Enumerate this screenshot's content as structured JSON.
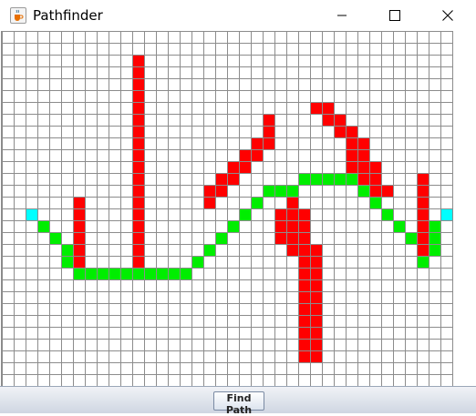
{
  "window": {
    "title": "Pathfinder",
    "app_icon": "java-coffee-cup-icon",
    "controls": [
      "minimize-icon",
      "maximize-icon",
      "close-icon"
    ]
  },
  "grid": {
    "cols": 38,
    "rows": 30,
    "colors": {
      "empty": "#ffffff",
      "line": "#8c8c8c",
      "wall": "#ff0000",
      "path": "#00ee00",
      "endpoint": "#00ffff"
    },
    "walls": [
      [
        11,
        2
      ],
      [
        11,
        3
      ],
      [
        11,
        4
      ],
      [
        11,
        5
      ],
      [
        11,
        6
      ],
      [
        11,
        7
      ],
      [
        11,
        8
      ],
      [
        11,
        9
      ],
      [
        11,
        10
      ],
      [
        11,
        11
      ],
      [
        11,
        12
      ],
      [
        11,
        13
      ],
      [
        11,
        14
      ],
      [
        11,
        15
      ],
      [
        11,
        16
      ],
      [
        11,
        17
      ],
      [
        11,
        18
      ],
      [
        11,
        19
      ],
      [
        6,
        14
      ],
      [
        6,
        15
      ],
      [
        6,
        16
      ],
      [
        6,
        17
      ],
      [
        6,
        18
      ],
      [
        6,
        19
      ],
      [
        22,
        7
      ],
      [
        22,
        8
      ],
      [
        22,
        9
      ],
      [
        21,
        9
      ],
      [
        21,
        10
      ],
      [
        20,
        10
      ],
      [
        20,
        11
      ],
      [
        19,
        11
      ],
      [
        19,
        12
      ],
      [
        18,
        12
      ],
      [
        18,
        13
      ],
      [
        17,
        13
      ],
      [
        17,
        14
      ],
      [
        26,
        6
      ],
      [
        27,
        6
      ],
      [
        27,
        7
      ],
      [
        28,
        7
      ],
      [
        28,
        8
      ],
      [
        29,
        8
      ],
      [
        29,
        9
      ],
      [
        30,
        9
      ],
      [
        29,
        10
      ],
      [
        30,
        10
      ],
      [
        29,
        11
      ],
      [
        30,
        11
      ],
      [
        31,
        11
      ],
      [
        30,
        12
      ],
      [
        31,
        12
      ],
      [
        31,
        13
      ],
      [
        32,
        13
      ],
      [
        24,
        14
      ],
      [
        24,
        15
      ],
      [
        23,
        15
      ],
      [
        25,
        15
      ],
      [
        23,
        16
      ],
      [
        24,
        16
      ],
      [
        25,
        16
      ],
      [
        23,
        17
      ],
      [
        24,
        17
      ],
      [
        25,
        17
      ],
      [
        24,
        18
      ],
      [
        25,
        18
      ],
      [
        26,
        18
      ],
      [
        25,
        19
      ],
      [
        26,
        19
      ],
      [
        25,
        20
      ],
      [
        26,
        20
      ],
      [
        25,
        21
      ],
      [
        26,
        21
      ],
      [
        25,
        22
      ],
      [
        26,
        22
      ],
      [
        25,
        23
      ],
      [
        26,
        23
      ],
      [
        25,
        24
      ],
      [
        26,
        24
      ],
      [
        25,
        25
      ],
      [
        26,
        25
      ],
      [
        25,
        26
      ],
      [
        26,
        26
      ],
      [
        25,
        27
      ],
      [
        26,
        27
      ],
      [
        35,
        12
      ],
      [
        35,
        13
      ],
      [
        35,
        14
      ],
      [
        35,
        15
      ],
      [
        35,
        16
      ],
      [
        35,
        17
      ],
      [
        35,
        18
      ]
    ],
    "path": [
      [
        3,
        16
      ],
      [
        4,
        17
      ],
      [
        5,
        18
      ],
      [
        5,
        19
      ],
      [
        6,
        20
      ],
      [
        7,
        20
      ],
      [
        8,
        20
      ],
      [
        9,
        20
      ],
      [
        10,
        20
      ],
      [
        11,
        20
      ],
      [
        12,
        20
      ],
      [
        13,
        20
      ],
      [
        14,
        20
      ],
      [
        15,
        20
      ],
      [
        16,
        19
      ],
      [
        17,
        18
      ],
      [
        18,
        17
      ],
      [
        19,
        16
      ],
      [
        20,
        15
      ],
      [
        21,
        14
      ],
      [
        22,
        13
      ],
      [
        23,
        13
      ],
      [
        24,
        13
      ],
      [
        25,
        12
      ],
      [
        26,
        12
      ],
      [
        27,
        12
      ],
      [
        28,
        12
      ],
      [
        29,
        12
      ],
      [
        30,
        13
      ],
      [
        31,
        14
      ],
      [
        32,
        15
      ],
      [
        33,
        16
      ],
      [
        34,
        17
      ],
      [
        35,
        19
      ],
      [
        36,
        18
      ],
      [
        36,
        17
      ],
      [
        36,
        16
      ]
    ],
    "endpoints": [
      [
        2,
        15
      ],
      [
        37,
        15
      ]
    ]
  },
  "toolbar": {
    "find_path_label": "Find Path"
  }
}
